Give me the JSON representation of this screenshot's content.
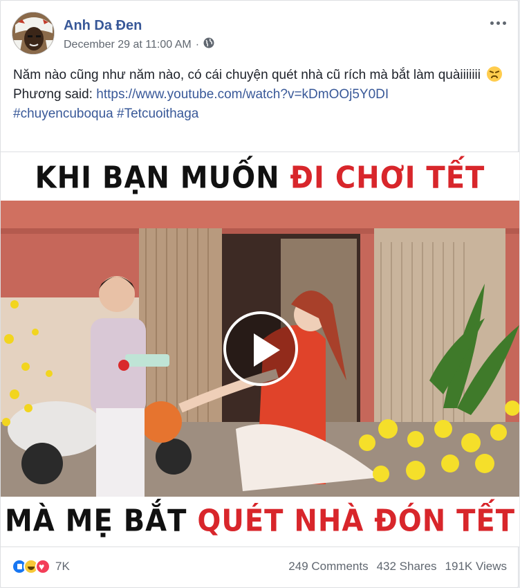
{
  "post": {
    "author": "Anh Da Đen",
    "timestamp": "December 29 at 11:00 AM",
    "separator": "·",
    "privacy_icon": "globe-icon",
    "text": {
      "line1": "Năm nào cũng như năm nào, có cái chuyện quét nhà cũ rích mà bắt làm quàiiiiiii",
      "said_prefix": "Phương said: ",
      "link": "https://www.youtube.com/watch?v=kDmOOj5Y0DI",
      "hashtag1": "#chuyencuboqua",
      "hashtag2": "#Tetcuoithaga"
    }
  },
  "video": {
    "caption_top_black": "KHI BẠN MUỐN ",
    "caption_top_red": "ĐI CHƠI TẾT",
    "caption_bottom_black": "MÀ MẸ BẮT ",
    "caption_bottom_red": "QUÉT NHÀ ĐÓN TẾT"
  },
  "footer": {
    "reaction_count": "7K",
    "comments": "249 Comments",
    "shares": "432 Shares",
    "views": "191K Views"
  },
  "colors": {
    "link": "#385898",
    "caption_red": "#d8262b",
    "like": "#1877f2",
    "love": "#f33e58",
    "haha": "#f7c837"
  }
}
